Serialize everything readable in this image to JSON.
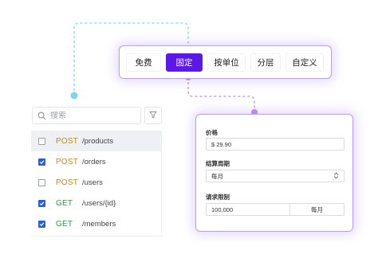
{
  "search": {
    "placeholder": "搜索"
  },
  "api_list": [
    {
      "method": "POST",
      "path": "/products",
      "checked": false,
      "selected": true
    },
    {
      "method": "POST",
      "path": "/orders",
      "checked": true,
      "selected": false
    },
    {
      "method": "POST",
      "path": "/users",
      "checked": false,
      "selected": false
    },
    {
      "method": "GET",
      "path": "/users/{id}",
      "checked": true,
      "selected": false
    },
    {
      "method": "GET",
      "path": "/members",
      "checked": true,
      "selected": false
    }
  ],
  "mode_tabs": [
    {
      "label": "免费",
      "active": false
    },
    {
      "label": "固定",
      "active": true
    },
    {
      "label": "按单位",
      "active": false
    },
    {
      "label": "分层",
      "active": false
    },
    {
      "label": "自定义",
      "active": false
    }
  ],
  "form": {
    "price_label": "价格",
    "price_value": "$ 29.90",
    "billing_label": "结算周期",
    "billing_value": "每月",
    "limit_label": "请求限制",
    "limit_value": "100,000",
    "limit_unit": "每月"
  },
  "colors": {
    "accent": "#5b18e6",
    "panel_border": "#b99df6",
    "connector_cyan": "#7fd6ea",
    "connector_purple": "#b98ef2",
    "post": "#c98a13",
    "get": "#2aa13c",
    "checkbox": "#2c5fd0"
  }
}
